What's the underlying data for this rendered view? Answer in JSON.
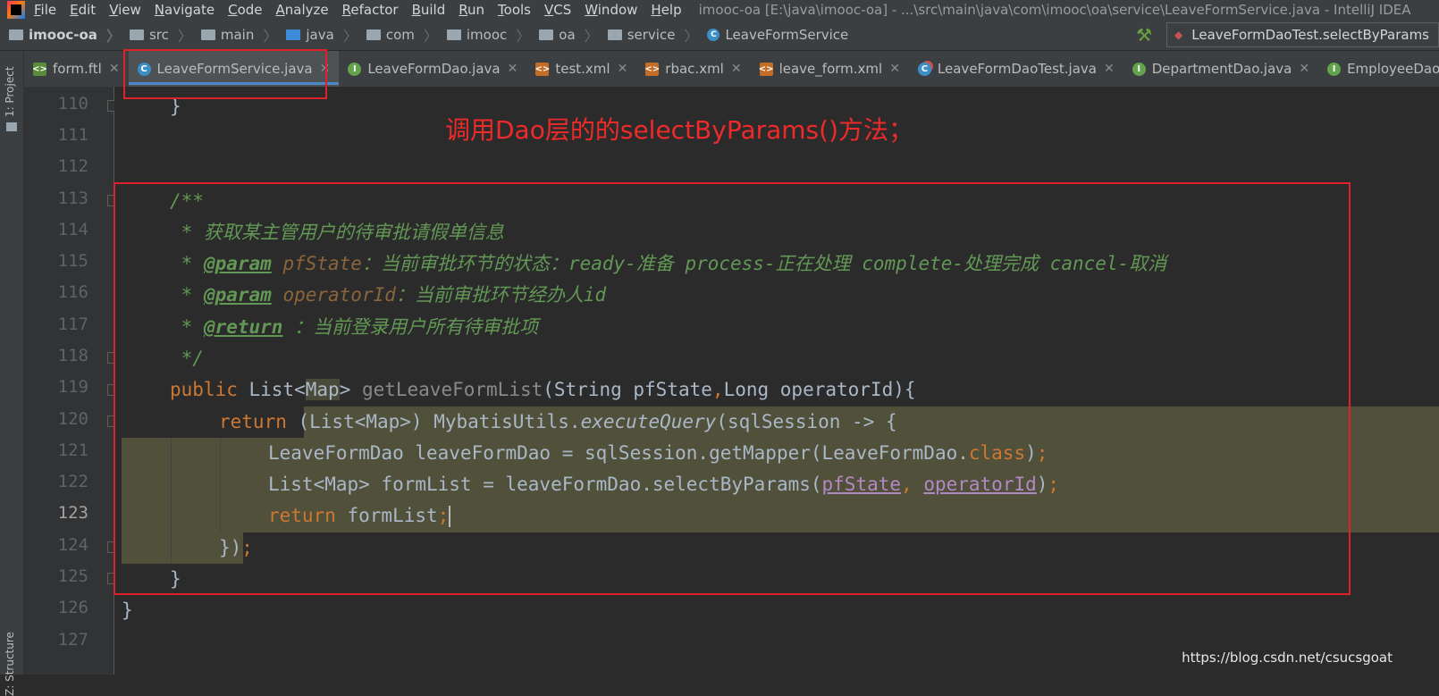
{
  "menubar": {
    "items": [
      "File",
      "Edit",
      "View",
      "Navigate",
      "Code",
      "Analyze",
      "Refactor",
      "Build",
      "Run",
      "Tools",
      "VCS",
      "Window",
      "Help"
    ],
    "window_title": "imooc-oa [E:\\java\\imooc-oa] - ...\\src\\main\\java\\com\\imooc\\oa\\service\\LeaveFormService.java - IntelliJ IDEA"
  },
  "breadcrumb": {
    "items": [
      "imooc-oa",
      "src",
      "main",
      "java",
      "com",
      "imooc",
      "oa",
      "service",
      "LeaveFormService"
    ]
  },
  "run_config": {
    "label": "LeaveFormDaoTest.selectByParams"
  },
  "tool_strip": {
    "project": "1: Project",
    "structure": "Z: Structure"
  },
  "tabs": [
    {
      "label": "form.ftl"
    },
    {
      "label": "LeaveFormService.java"
    },
    {
      "label": "LeaveFormDao.java"
    },
    {
      "label": "test.xml"
    },
    {
      "label": "rbac.xml"
    },
    {
      "label": "leave_form.xml"
    },
    {
      "label": "LeaveFormDaoTest.java"
    },
    {
      "label": "DepartmentDao.java"
    },
    {
      "label": "EmployeeDao.java"
    }
  ],
  "editor": {
    "line_numbers": [
      "110",
      "111",
      "112",
      "113",
      "114",
      "115",
      "116",
      "117",
      "118",
      "119",
      "120",
      "121",
      "122",
      "123",
      "124",
      "125",
      "126",
      "127"
    ],
    "current_line": "123",
    "code": {
      "l110": "}",
      "l113": "/**",
      "l114": " * 获取某主管用户的待审批请假单信息",
      "l115_star": " * ",
      "l115_tag": "@param",
      "l115_name": " pfState",
      "l115_desc": "：当前审批环节的状态：ready-准备 process-正在处理 complete-处理完成 cancel-取消",
      "l116_star": " * ",
      "l116_tag": "@param",
      "l116_name": " operatorId",
      "l116_desc": "：当前审批环节经办人id",
      "l117_star": " * ",
      "l117_tag": "@return",
      "l117_desc": " ：当前登录用户所有待审批项",
      "l118": " */",
      "l119_kw": "public",
      "l119_a": " List<",
      "l119_map": "Map",
      "l119_b": "> ",
      "l119_fn": "getLeaveFormList",
      "l119_c": "(String pfState",
      "l119_comma": ",",
      "l119_d": "Long operatorId){",
      "l120_kw": "return",
      "l120_a": " (List<Map>) MybatisUtils.",
      "l120_call": "executeQuery",
      "l120_b": "(sqlSession -> {",
      "l121_a": "LeaveFormDao leaveFormDao = sqlSession.getMapper(LeaveFormDao.",
      "l121_kw": "class",
      "l121_b": ")",
      "l121_semi": ";",
      "l122_a": "List<Map> formList = leaveFormDao.selectByParams(",
      "l122_p1": "pfState",
      "l122_comma": ", ",
      "l122_p2": "operatorId",
      "l122_b": ")",
      "l122_semi": ";",
      "l123_kw": "return",
      "l123_a": " formList",
      "l123_semi": ";",
      "l124_a": "})",
      "l124_semi": ";",
      "l125": "}",
      "l126": "}"
    }
  },
  "annotation": {
    "text": "调用Dao层的的selectByParams()方法；"
  },
  "watermark": {
    "text": "https://blog.csdn.net/csucsgoat"
  }
}
